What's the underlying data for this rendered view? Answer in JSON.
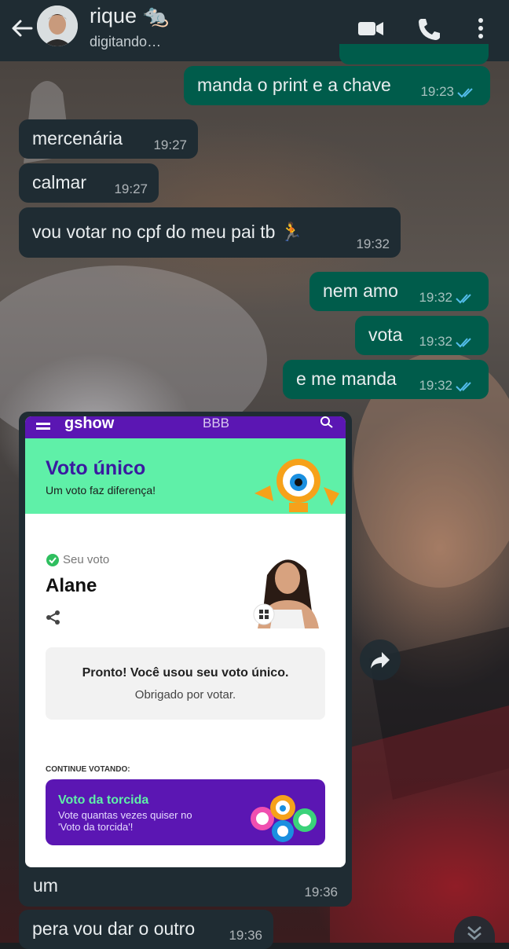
{
  "header": {
    "contact_name": "rique 🐀",
    "status": "digitando…",
    "icons": [
      "back-arrow-icon",
      "avatar",
      "video-call-icon",
      "phone-icon",
      "more-options-icon"
    ]
  },
  "messages": [
    {
      "dir": "out",
      "text": "manda o print e a chave",
      "time": "19:23"
    },
    {
      "dir": "in",
      "text": "mercenária",
      "time": "19:27"
    },
    {
      "dir": "in",
      "text": "calmar",
      "time": "19:27"
    },
    {
      "dir": "in",
      "text": "vou votar no cpf do meu pai tb 🏃",
      "time": "19:32"
    },
    {
      "dir": "out",
      "text": "nem amo",
      "time": "19:32"
    },
    {
      "dir": "out",
      "text": "vota",
      "time": "19:32"
    },
    {
      "dir": "out",
      "text": "e me manda",
      "time": "19:32"
    }
  ],
  "image_message": {
    "caption": "um",
    "time": "19:36",
    "screenshot": {
      "brand": "gshow",
      "tab": "BBB",
      "banner_title": "Voto único",
      "banner_subtitle": "Um voto faz diferença!",
      "vote_label": "Seu voto",
      "candidate": "Alane",
      "confirm_title": "Pronto! Você usou seu voto único.",
      "confirm_sub": "Obrigado por votar.",
      "continue_label": "CONTINUE VOTANDO:",
      "promo_title": "Voto da torcida",
      "promo_text_1": "Vote quantas vezes quiser no",
      "promo_text_2": "'Voto da torcida'!"
    }
  },
  "last_message": {
    "dir": "in",
    "text": "pera vou dar o outro",
    "time": "19:36"
  },
  "colors": {
    "header_bg": "#1f2c33",
    "incoming_bubble": "#1f2c33",
    "outgoing_bubble": "#005c4b",
    "read_ticks": "#53bdeb",
    "gshow_purple": "#5b16b3",
    "banner_green": "#5ff0a8"
  }
}
